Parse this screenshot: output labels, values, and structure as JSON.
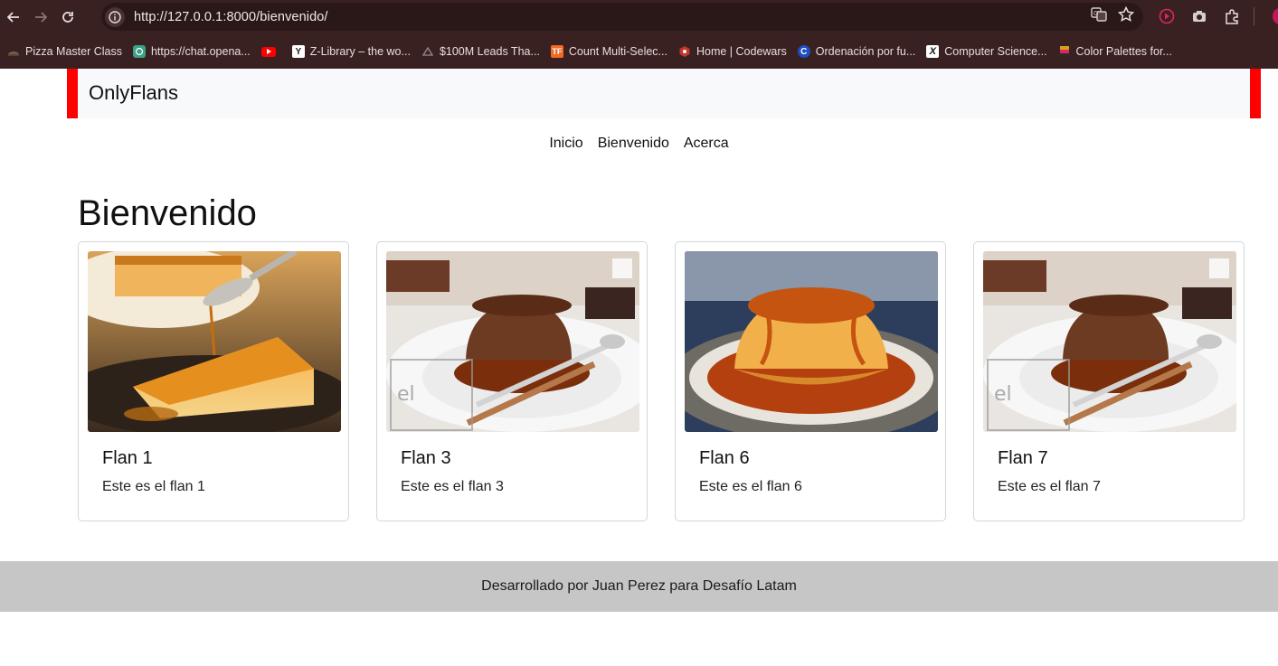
{
  "browser": {
    "url": "http://127.0.0.1:8000/bienvenido/",
    "bookmarks": [
      {
        "label": "Pizza Master Class",
        "icon": "pizza-icon",
        "color": "#7a5a4a"
      },
      {
        "label": "https://chat.opena...",
        "icon": "chatgpt-icon",
        "color": "#3aa186"
      },
      {
        "label": "",
        "icon": "youtube-icon",
        "color": "#ff0000"
      },
      {
        "label": "Z-Library – the wo...",
        "icon": "zlibrary-icon",
        "color": "#ffffff"
      },
      {
        "label": "$100M Leads Tha...",
        "icon": "triangle-icon",
        "color": "#555555"
      },
      {
        "label": "Count Multi-Selec...",
        "icon": "typeform-icon",
        "color": "#f06a23"
      },
      {
        "label": "Home | Codewars",
        "icon": "codewars-icon",
        "color": "#c4362b"
      },
      {
        "label": "Ordenación por fu...",
        "icon": "c-icon",
        "color": "#1b4fc4"
      },
      {
        "label": "Computer Science...",
        "icon": "x-icon",
        "color": "#111111"
      },
      {
        "label": "Color Palettes for...",
        "icon": "palette-icon",
        "color": "#d4a11a"
      }
    ]
  },
  "brand": "OnlyFlans",
  "nav": {
    "items": [
      "Inicio",
      "Bienvenido",
      "Acerca"
    ]
  },
  "heading": "Bienvenido",
  "cards": [
    {
      "title": "Flan 1",
      "text": "Este es el flan 1"
    },
    {
      "title": "Flan 3",
      "text": "Este es el flan 3"
    },
    {
      "title": "Flan 6",
      "text": "Este es el flan 6"
    },
    {
      "title": "Flan 7",
      "text": "Este es el flan 7"
    }
  ],
  "footer": "Desarrollado por Juan Perez para Desafío Latam",
  "colors": {
    "accent": "#ff0000",
    "navbar_bg": "#f8f9fa",
    "footer_bg": "#c6c6c6"
  }
}
